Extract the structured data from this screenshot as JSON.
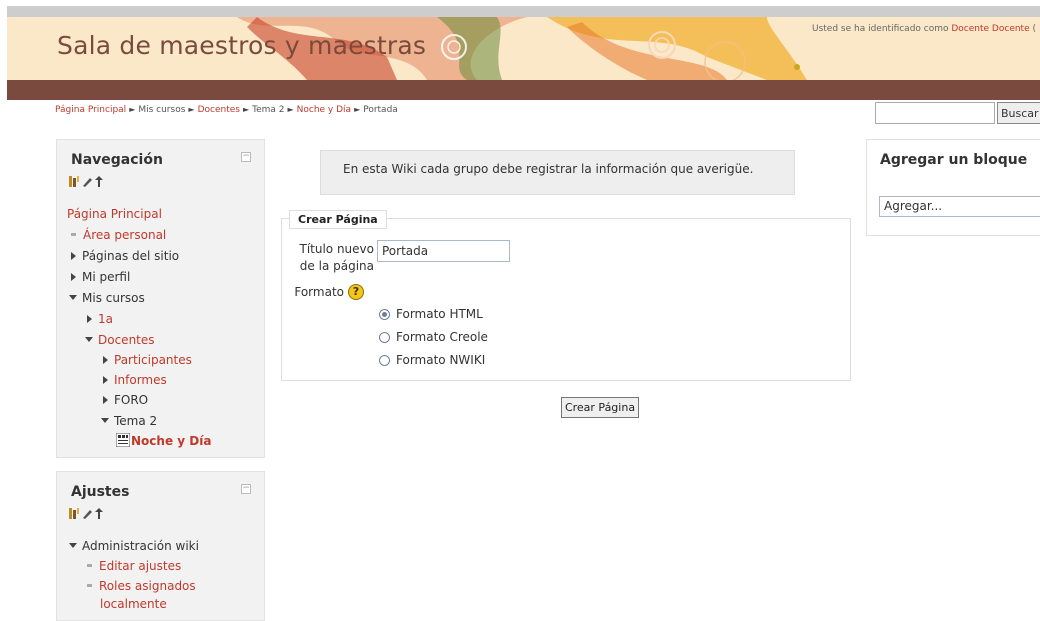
{
  "header": {
    "site_title": "Sala de maestros y maestras",
    "login_prefix": "Usted se ha identificado como ",
    "login_user": "Docente Docente",
    "login_suffix": " ("
  },
  "breadcrumb": {
    "items": [
      "Página Principal",
      "Mis cursos",
      "Docentes",
      "Tema 2",
      "Noche y Día",
      "Portada"
    ],
    "separator": "►"
  },
  "search": {
    "value": "",
    "button_label": "Buscar"
  },
  "navigation": {
    "title": "Navegación",
    "collapse_symbol": "−",
    "items": [
      {
        "label": "Página Principal"
      },
      {
        "label": "Área personal"
      },
      {
        "label": "Páginas del sitio"
      },
      {
        "label": "Mi perfil"
      },
      {
        "label": "Mis cursos"
      },
      {
        "label": "1a"
      },
      {
        "label": "Docentes"
      },
      {
        "label": "Participantes"
      },
      {
        "label": "Informes"
      },
      {
        "label": "FORO"
      },
      {
        "label": "Tema 2"
      },
      {
        "label": "Noche y Día"
      }
    ]
  },
  "settings": {
    "title": "Ajustes",
    "collapse_symbol": "−",
    "items": [
      {
        "label": "Administración wiki"
      },
      {
        "label": "Editar ajustes"
      },
      {
        "label": "Roles asignados"
      },
      {
        "label": "localmente"
      }
    ]
  },
  "main": {
    "intro_text": "En esta Wiki cada grupo debe registrar la información que averigüe.",
    "fieldset_legend": "Crear Página",
    "title_label_line1": "Título nuevo",
    "title_label_line2": "de la página",
    "title_value": "Portada",
    "format_label": "Formato",
    "help_symbol": "?",
    "formats": [
      {
        "label": "Formato HTML",
        "checked": true
      },
      {
        "label": "Formato Creole",
        "checked": false
      },
      {
        "label": "Formato NWIKI",
        "checked": false
      }
    ],
    "submit_label": "Crear Página"
  },
  "add_block": {
    "title": "Agregar un bloque",
    "select_value": "Agregar..."
  },
  "colors": {
    "link": "#c0392b",
    "header_bg": "#fbe8c9",
    "brown_bar": "#7b4a3f",
    "site_title": "#7a4b3c"
  },
  "icons": [
    "move-icon",
    "edit-icon",
    "hide-icon",
    "help-icon",
    "collapse-icon",
    "wiki-icon"
  ]
}
